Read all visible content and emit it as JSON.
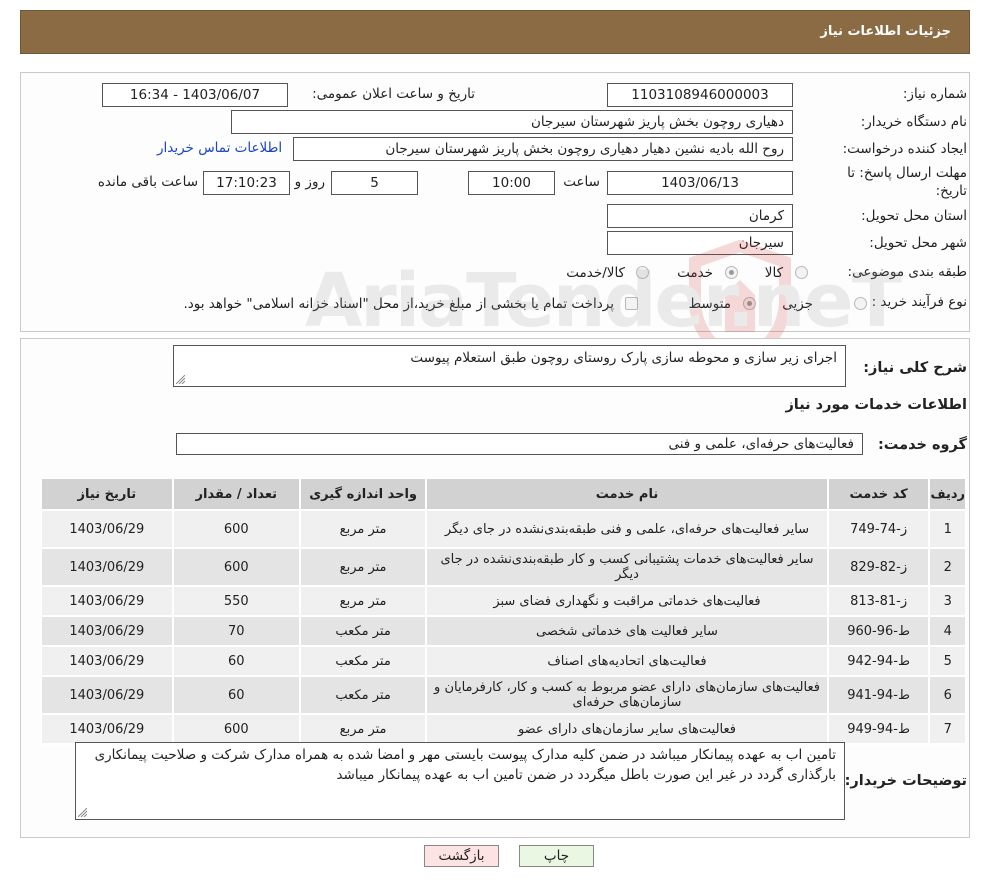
{
  "header": {
    "title": "جزئیات اطلاعات نیاز"
  },
  "form": {
    "need_number_label": "شماره نیاز:",
    "need_number": "1103108946000003",
    "announce_label": "تاریخ و ساعت اعلان عمومی:",
    "announce_value": "1403/06/07 - 16:34",
    "buyer_org_label": "نام دستگاه خریدار:",
    "buyer_org": "دهیاری روچون بخش پاریز شهرستان سیرجان",
    "creator_label": "ایجاد کننده درخواست:",
    "creator": "روح الله بادیه نشین دهیار دهیاری روچون بخش پاریز شهرستان سیرجان",
    "contact_link": "اطلاعات تماس خریدار",
    "deadline_label_1": "مهلت ارسال پاسخ: تا",
    "deadline_label_2": "تاریخ:",
    "deadline_date": "1403/06/13",
    "time_label": "ساعت",
    "deadline_time": "10:00",
    "days_value": "5",
    "days_label": "روز و",
    "remaining_time": "17:10:23",
    "remaining_label": "ساعت باقی مانده",
    "province_label": "استان محل تحویل:",
    "province": "کرمان",
    "city_label": "شهر محل تحویل:",
    "city": "سیرجان",
    "category_label": "طبقه بندی موضوعی:",
    "category_options": [
      "کالا",
      "خدمت",
      "کالا/خدمت"
    ],
    "category_selected": "خدمت",
    "process_label": "نوع فرآیند خرید :",
    "process_options": [
      "جزیی",
      "متوسط"
    ],
    "process_selected": "متوسط",
    "payment_note": "پرداخت تمام یا بخشی از مبلغ خرید،از محل \"اسناد خزانه اسلامی\" خواهد بود."
  },
  "description": {
    "label": "شرح کلی نیاز:",
    "text": "اجرای زیر سازی و محوطه سازی پارک روستای روچون طبق استعلام پیوست"
  },
  "services": {
    "section_title": "اطلاعات خدمات مورد نیاز",
    "group_label": "گروه خدمت:",
    "group_value": "فعالیت‌های حرفه‌ای، علمی و فنی",
    "columns": [
      "ردیف",
      "کد خدمت",
      "نام خدمت",
      "واحد اندازه گیری",
      "تعداد / مقدار",
      "تاریخ نیاز"
    ],
    "rows": [
      [
        "1",
        "ز-74-749",
        "سایر فعالیت‌های حرفه‌ای، علمی و فنی طبقه‌بندی‌نشده در جای دیگر",
        "متر مربع",
        "600",
        "1403/06/29"
      ],
      [
        "2",
        "ز-82-829",
        "سایر فعالیت‌های خدمات پشتیبانی کسب و کار طبقه‌بندی‌نشده در جای دیگر",
        "متر مربع",
        "600",
        "1403/06/29"
      ],
      [
        "3",
        "ز-81-813",
        "فعالیت‌های خدماتی مراقبت و نگهداری فضای سبز",
        "متر مربع",
        "550",
        "1403/06/29"
      ],
      [
        "4",
        "ط-96-960",
        "سایر فعالیت های خدماتی شخصی",
        "متر مکعب",
        "70",
        "1403/06/29"
      ],
      [
        "5",
        "ط-94-942",
        "فعالیت‌های اتحادیه‌های اصناف",
        "متر مکعب",
        "60",
        "1403/06/29"
      ],
      [
        "6",
        "ط-94-941",
        "فعالیت‌های سازمان‌های دارای عضو مربوط به کسب و کار، کارفرمایان و سازمان‌های حرفه‌ای",
        "متر مکعب",
        "60",
        "1403/06/29"
      ],
      [
        "7",
        "ط-94-949",
        "فعالیت‌های سایر سازمان‌های دارای عضو",
        "متر مربع",
        "600",
        "1403/06/29"
      ]
    ]
  },
  "buyer_notes": {
    "label": "توضیحات خریدار:",
    "text": "تامین اب  به عهده پیمانکار میباشد در ضمن کلیه مدارک پیوست بایستی مهر و امضا شده  به همراه مدارک شرکت و صلاحیت پیمانکاری بارگذاری گردد در غیر این صورت باطل میگردد در ضمن تامین اب به عهده پیمانکار میباشد"
  },
  "buttons": {
    "print": "چاپ",
    "back": "بازگشت"
  },
  "watermark": "AriaTender.neT",
  "colors": {
    "header_bg": "#8b6b44",
    "link": "#1a43c8",
    "table_header": "#d2d2d2"
  }
}
